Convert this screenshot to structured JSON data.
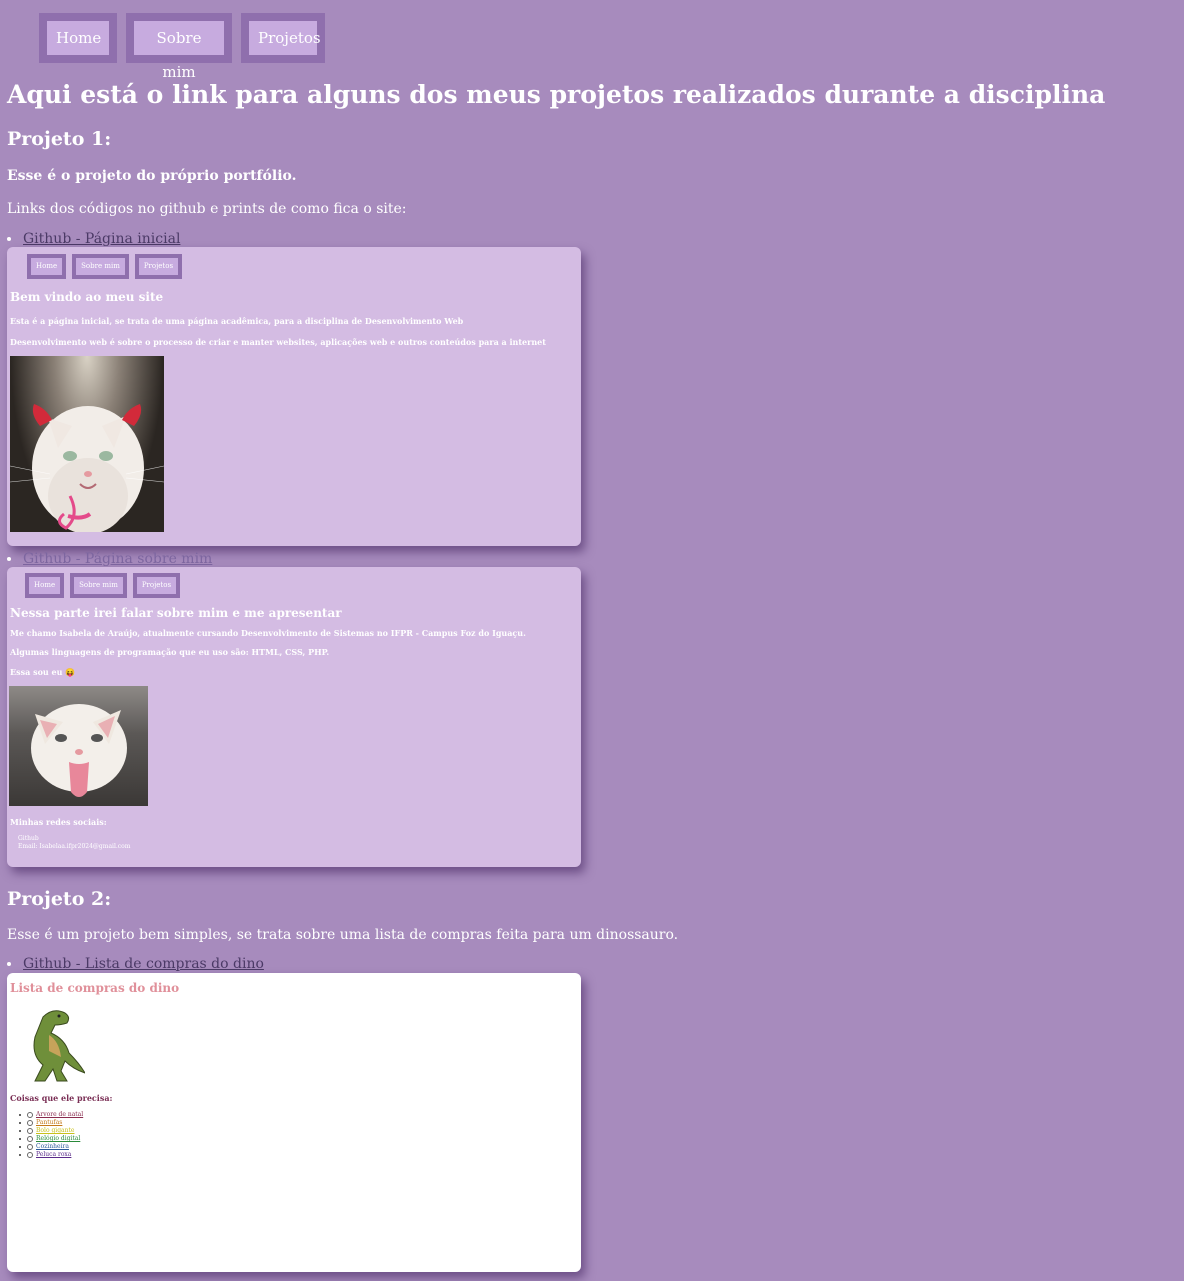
{
  "nav": [
    "Home",
    "Sobre mim",
    "Projetos"
  ],
  "title": "Aqui está o link para alguns dos meus projetos realizados durante a disciplina",
  "project1": {
    "heading": "Projeto 1:",
    "subtitle": "Esse é o projeto do próprio portfólio.",
    "links_intro": "Links dos códigos no github e prints de como fica o site:",
    "link1": "Github - Página inicial",
    "link2": "Github - Página sobre mim"
  },
  "shot1": {
    "nav": [
      "Home",
      "Sobre mim",
      "Projetos"
    ],
    "heading": "Bem vindo ao meu site",
    "line1": "Esta é a página inicial, se trata de uma página acadêmica, para a disciplina de Desenvolvimento Web",
    "line2": "Desenvolvimento web é sobre o processo de criar e manter websites, aplicações web e outros conteúdos para a internet"
  },
  "shot2": {
    "nav": [
      "Home",
      "Sobre mim",
      "Projetos"
    ],
    "heading": "Nessa parte irei falar sobre mim e me apresentar",
    "line1": "Me chamo Isabela de Araújo, atualmente cursando Desenvolvimento de Sistemas no IFPR - Campus Foz do Iguaçu.",
    "line2": "Algumas linguagens de programação que eu uso são: HTML, CSS, PHP.",
    "line3": "Essa sou eu 😝",
    "social_label": "Minhas redes sociais:",
    "social": [
      "Github",
      "Email: Isabelaa.ifpr2024@gmail.com"
    ]
  },
  "project2": {
    "heading": "Projeto 2:",
    "desc": "Esse é um projeto bem simples, se trata sobre uma lista de compras feita para um dinossauro.",
    "link": "Github - Lista de compras do dino"
  },
  "shot3": {
    "heading": "Lista de compras do dino",
    "need": "Coisas que ele precisa:",
    "items": [
      {
        "label": "Arvore de natal",
        "color": "#8b2b4f"
      },
      {
        "label": "Pantufas",
        "color": "#c47a1a"
      },
      {
        "label": "Bolo gigante",
        "color": "#c9c21a"
      },
      {
        "label": "Relógio digital",
        "color": "#2a8a3a"
      },
      {
        "label": "Cozinheira",
        "color": "#2a5a9a"
      },
      {
        "label": "Peluca roxa",
        "color": "#5a2a8a"
      }
    ]
  }
}
